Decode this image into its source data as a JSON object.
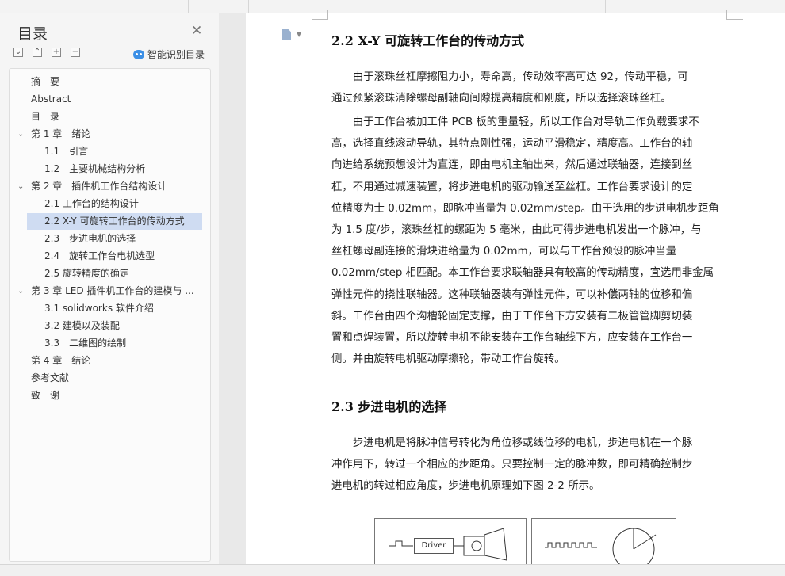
{
  "sidebar": {
    "title": "目录",
    "smart_toc_label": "智能识别目录",
    "items": [
      {
        "label": "摘　要",
        "level": 0,
        "toggle": false
      },
      {
        "label": "Abstract",
        "level": 0,
        "toggle": false
      },
      {
        "label": "目　录",
        "level": 0,
        "toggle": false
      },
      {
        "label": "第 1 章　绪论",
        "level": 0,
        "toggle": true
      },
      {
        "label": "1.1　引言",
        "level": 1,
        "toggle": false
      },
      {
        "label": "1.2　主要机械结构分析",
        "level": 1,
        "toggle": false
      },
      {
        "label": "第 2 章　插件机工作台结构设计",
        "level": 0,
        "toggle": true
      },
      {
        "label": "2.1 工作台的结构设计",
        "level": 1,
        "toggle": false
      },
      {
        "label": "2.2 X-Y 可旋转工作台的传动方式",
        "level": 1,
        "toggle": false,
        "active": true
      },
      {
        "label": "2.3　步进电机的选择",
        "level": 1,
        "toggle": false
      },
      {
        "label": "2.4　旋转工作台电机选型",
        "level": 1,
        "toggle": false
      },
      {
        "label": "2.5 旋转精度的确定",
        "level": 1,
        "toggle": false
      },
      {
        "label": "第 3 章 LED 插件机工作台的建模与 ...",
        "level": 0,
        "toggle": true
      },
      {
        "label": "3.1 solidworks 软件介绍",
        "level": 1,
        "toggle": false
      },
      {
        "label": "3.2 建模以及装配",
        "level": 1,
        "toggle": false
      },
      {
        "label": "3.3　二维图的绘制",
        "level": 1,
        "toggle": false
      },
      {
        "label": "第 4 章　结论",
        "level": 0,
        "toggle": false
      },
      {
        "label": "参考文献",
        "level": 0,
        "toggle": false
      },
      {
        "label": "致　谢",
        "level": 0,
        "toggle": false
      }
    ]
  },
  "document": {
    "section_22_title": "2.2 X-Y 可旋转工作台的传动方式",
    "para1": [
      "　　由于滚珠丝杠摩擦阻力小，寿命高，传动效率高可达 92，传动平稳，可",
      "通过预紧滚珠消除螺母副轴向间隙提高精度和刚度，所以选择滚珠丝杠。"
    ],
    "para2": [
      "　　由于工作台被加工件 PCB 板的重量轻，所以工作台对导轨工作负载要求不",
      "高，选择直线滚动导轨，其特点刚性强，运动平滑稳定，精度高。工作台的轴",
      "向进给系统预想设计为直连，即由电机主轴出来，然后通过联轴器，连接到丝",
      "杠，不用通过减速装置，将步进电机的驱动输送至丝杠。工作台要求设计的定",
      "位精度为士 0.02mm，即脉冲当量为 0.02mm/step。由于选用的步进电机步距角",
      "为 1.5 度/步，滚珠丝杠的螺距为 5 毫米，由此可得步进电机发出一个脉冲，与",
      "丝杠螺母副连接的滑块进给量为 0.02mm，可以与工作台预设的脉冲当量",
      "0.02mm/step 相匹配。本工作台要求联轴器具有较高的传动精度，宜选用非金属",
      "弹性元件的挠性联轴器。这种联轴器装有弹性元件，可以补偿两轴的位移和偏",
      "斜。工作台由四个沟槽轮固定支撑，由于工作台下方安装有二极管管脚剪切装",
      "置和点焊装置，所以旋转电机不能安装在工作台轴线下方，应安装在工作台一",
      "侧。并由旋转电机驱动摩擦轮，带动工作台旋转。"
    ],
    "section_23_title": "2.3  步进电机的选择",
    "para3": [
      "　　步进电机是将脉冲信号转化为角位移或线位移的电机，步进电机在一个脉",
      "冲作用下，转过一个相应的步距角。只要控制一定的脉冲数，即可精确控制步",
      "进电机的转过相应角度，步进电机原理如下图 2-2 所示。"
    ],
    "figure_driver_label": "Driver"
  },
  "colors": {
    "active_item_bg": "#cfdcf2",
    "smart_icon": "#3b8fe6",
    "sidebar_bg": "#f5f5f5"
  }
}
